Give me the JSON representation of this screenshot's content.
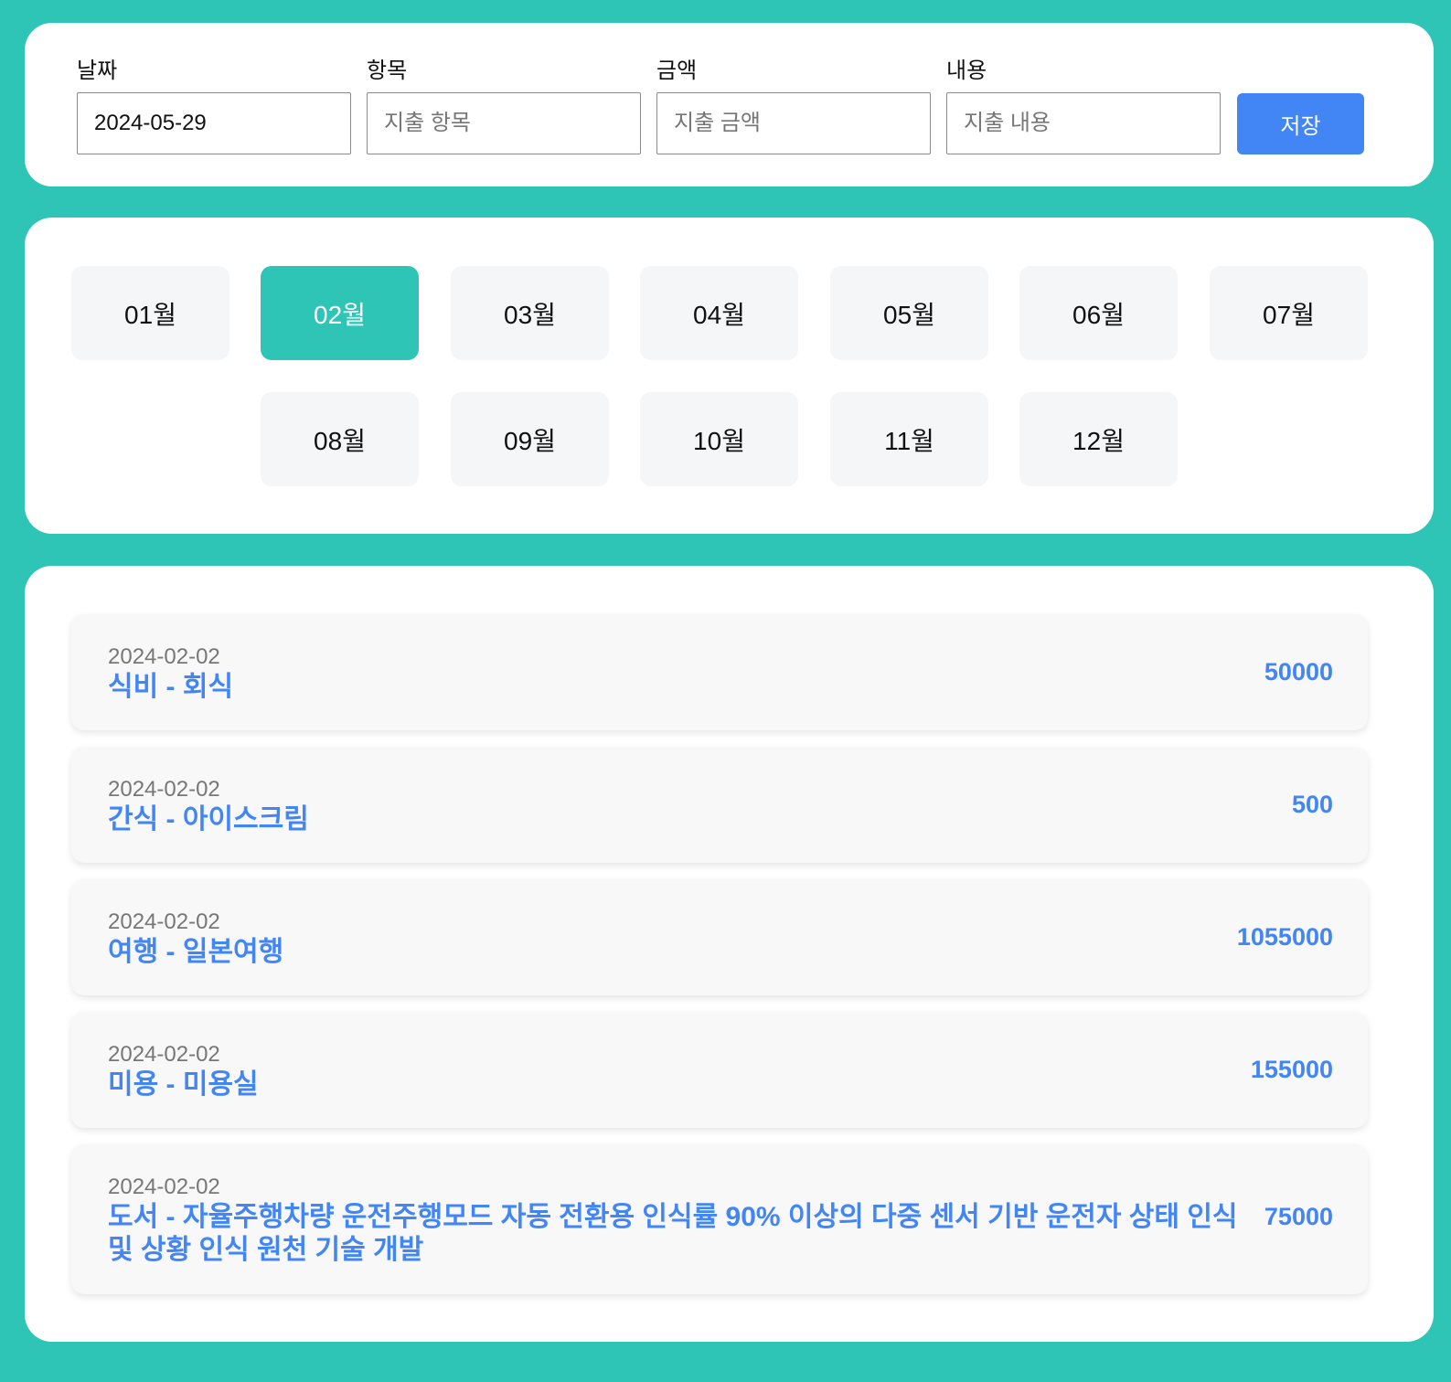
{
  "form": {
    "date_label": "날짜",
    "date_value": "2024-05-29",
    "item_label": "항목",
    "item_placeholder": "지출 항목",
    "amount_label": "금액",
    "amount_placeholder": "지출 금액",
    "content_label": "내용",
    "content_placeholder": "지출 내용",
    "save_label": "저장"
  },
  "months": [
    "01월",
    "02월",
    "03월",
    "04월",
    "05월",
    "06월",
    "07월",
    "08월",
    "09월",
    "10월",
    "11월",
    "12월"
  ],
  "selected_month": "02월",
  "entries": [
    {
      "date": "2024-02-02",
      "title": "식비 - 회식",
      "amount": "50000"
    },
    {
      "date": "2024-02-02",
      "title": "간식 - 아이스크림",
      "amount": "500"
    },
    {
      "date": "2024-02-02",
      "title": "여행 - 일본여행",
      "amount": "1055000"
    },
    {
      "date": "2024-02-02",
      "title": "미용 - 미용실",
      "amount": "155000"
    },
    {
      "date": "2024-02-02",
      "title": "도서 - 자율주행차량 운전주행모드 자동 전환용 인식률 90% 이상의 다중 센서 기반 운전자 상태 인식 및 상황 인식 원천 기술 개발",
      "amount": "75000"
    }
  ],
  "colors": {
    "background": "#2ec4b6",
    "accent": "#4285f4",
    "selected_month": "#2ec4b6"
  }
}
